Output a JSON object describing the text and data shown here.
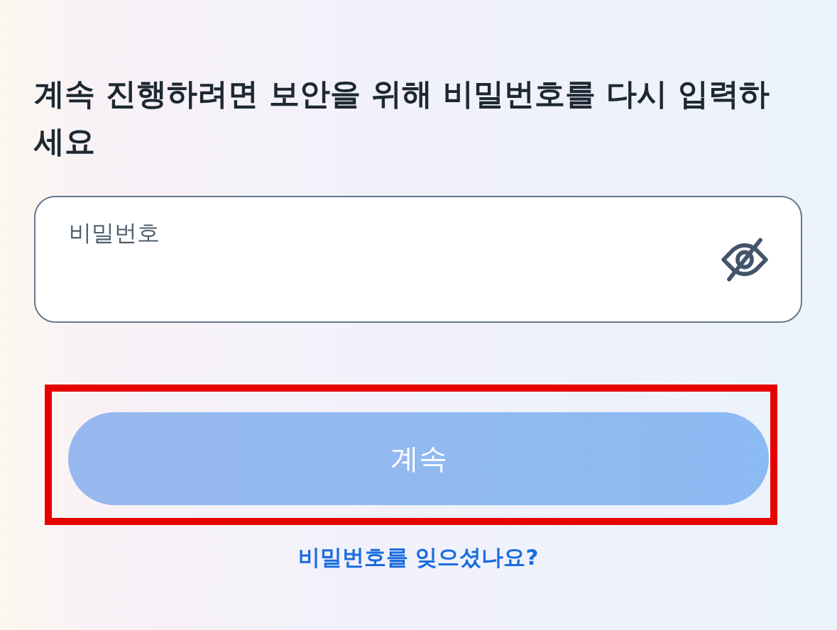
{
  "heading": "계속 진행하려면 보안을 위해 비밀번호를 다시 입력하세요",
  "password_field": {
    "label": "비밀번호",
    "password_visible": false
  },
  "continue_button": {
    "label": "계속",
    "disabled": true,
    "highlighted": true
  },
  "forgot_password_link": "비밀번호를 잊으셨나요?"
}
